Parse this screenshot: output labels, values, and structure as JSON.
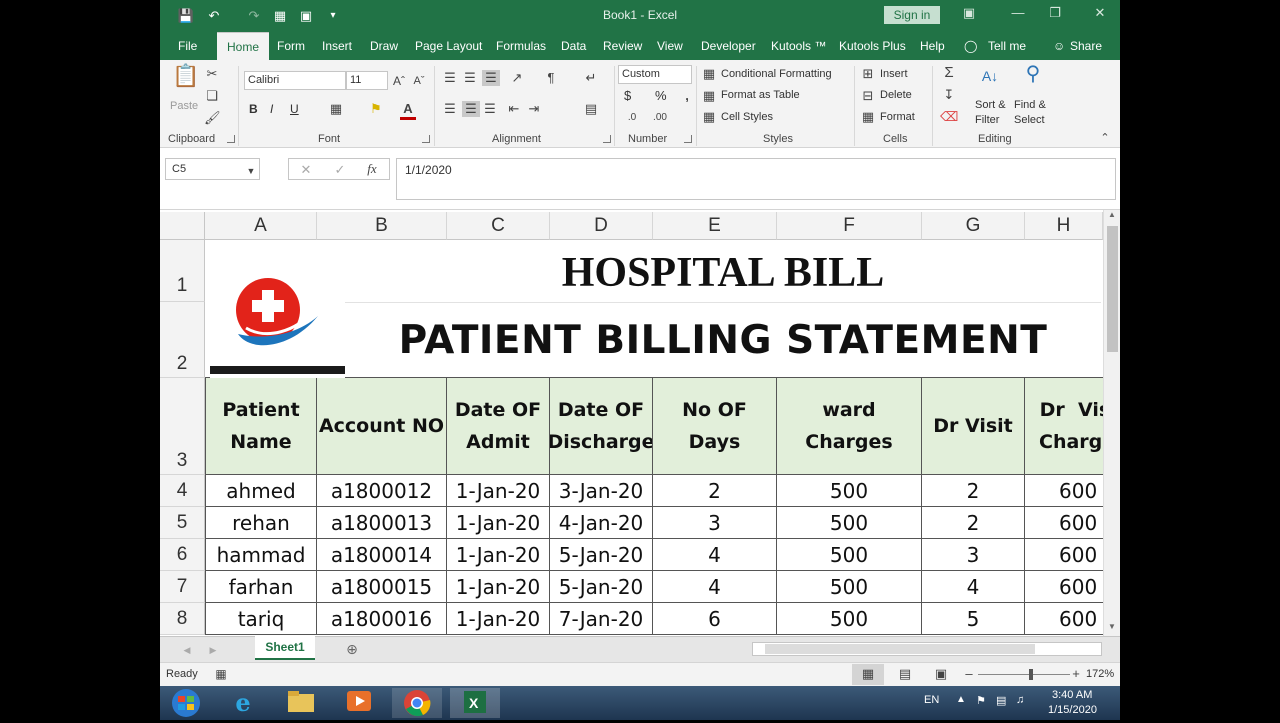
{
  "app": {
    "document_title": "Book1 - Excel",
    "signin_label": "Sign in",
    "tabs": [
      "File",
      "Home",
      "Form",
      "Insert",
      "Draw",
      "Page Layout",
      "Formulas",
      "Data",
      "Review",
      "View",
      "Developer",
      "Kutools ™",
      "Kutools Plus",
      "Help"
    ],
    "tell_me": "Tell me",
    "share": "Share"
  },
  "ribbon": {
    "clipboard": {
      "label": "Clipboard",
      "paste": "Paste"
    },
    "font": {
      "label": "Font",
      "name": "Calibri",
      "size": "11",
      "bold": "B",
      "italic": "I",
      "underline": "U"
    },
    "alignment": {
      "label": "Alignment"
    },
    "number": {
      "label": "Number",
      "format": "Custom",
      "currency": "$",
      "percent": "%"
    },
    "styles": {
      "label": "Styles",
      "conditional": "Conditional Formatting",
      "format_table": "Format as Table",
      "cell_styles": "Cell Styles"
    },
    "cells": {
      "label": "Cells",
      "insert": "Insert",
      "delete": "Delete",
      "format": "Format"
    },
    "editing": {
      "label": "Editing",
      "sort_filter_1": "Sort &",
      "sort_filter_2": "Filter",
      "find_select_1": "Find &",
      "find_select_2": "Select"
    }
  },
  "formula_bar": {
    "name_box": "C5",
    "fx": "fx",
    "value": "1/1/2020"
  },
  "grid": {
    "columns": [
      "A",
      "B",
      "C",
      "D",
      "E",
      "F",
      "G",
      "H"
    ],
    "row_numbers": [
      "1",
      "2",
      "3",
      "4",
      "5",
      "6",
      "7",
      "8"
    ],
    "title": "HOSPITAL BILL",
    "subtitle": "PATIENT BILLING STATEMENT",
    "headers": [
      [
        "Patient",
        "Name"
      ],
      [
        "Account NO"
      ],
      [
        "Date OF",
        "Admit"
      ],
      [
        "Date OF",
        "Discharge"
      ],
      [
        "No OF Days"
      ],
      [
        "ward Charges"
      ],
      [
        "Dr Visit"
      ],
      [
        "Dr  Visit",
        "Charges"
      ]
    ],
    "rows": [
      [
        "ahmed",
        "a1800012",
        "1-Jan-20",
        "3-Jan-20",
        "2",
        "500",
        "2",
        "600"
      ],
      [
        "rehan",
        "a1800013",
        "1-Jan-20",
        "4-Jan-20",
        "3",
        "500",
        "2",
        "600"
      ],
      [
        "hammad",
        "a1800014",
        "1-Jan-20",
        "5-Jan-20",
        "4",
        "500",
        "3",
        "600"
      ],
      [
        "farhan",
        "a1800015",
        "1-Jan-20",
        "5-Jan-20",
        "4",
        "500",
        "4",
        "600"
      ],
      [
        "tariq",
        "a1800016",
        "1-Jan-20",
        "7-Jan-20",
        "6",
        "500",
        "5",
        "600"
      ]
    ]
  },
  "sheet_tabs": {
    "active": "Sheet1"
  },
  "status": {
    "mode": "Ready",
    "zoom": "172%"
  },
  "taskbar": {
    "language": "EN",
    "time": "3:40 AM",
    "date": "1/15/2020"
  },
  "colors": {
    "excel_green": "#217346",
    "header_fill": "#e2efda",
    "logo_red": "#e2231a",
    "logo_blue": "#1d75bc"
  }
}
